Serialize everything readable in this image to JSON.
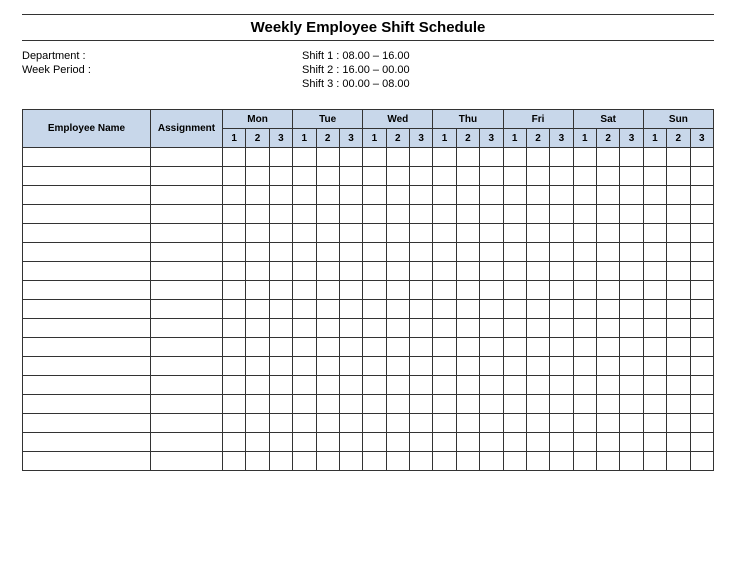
{
  "title": "Weekly Employee Shift Schedule",
  "meta": {
    "department_label": "Department    :",
    "week_period_label": "Week Period :",
    "shift1": "Shift 1  : 08.00  – 16.00",
    "shift2": "Shift 2  : 16.00  – 00.00",
    "shift3": "Shift 3  : 00.00  – 08.00"
  },
  "headers": {
    "employee": "Employee Name",
    "assignment": "Assignment",
    "days": [
      "Mon",
      "Tue",
      "Wed",
      "Thu",
      "Fri",
      "Sat",
      "Sun"
    ],
    "shifts": [
      "1",
      "2",
      "3"
    ]
  },
  "rows": [
    {
      "employee": "",
      "assignment": "",
      "cells": [
        "",
        "",
        "",
        "",
        "",
        "",
        "",
        "",
        "",
        "",
        "",
        "",
        "",
        "",
        "",
        "",
        "",
        "",
        "",
        "",
        ""
      ]
    },
    {
      "employee": "",
      "assignment": "",
      "cells": [
        "",
        "",
        "",
        "",
        "",
        "",
        "",
        "",
        "",
        "",
        "",
        "",
        "",
        "",
        "",
        "",
        "",
        "",
        "",
        "",
        ""
      ]
    },
    {
      "employee": "",
      "assignment": "",
      "cells": [
        "",
        "",
        "",
        "",
        "",
        "",
        "",
        "",
        "",
        "",
        "",
        "",
        "",
        "",
        "",
        "",
        "",
        "",
        "",
        "",
        ""
      ]
    },
    {
      "employee": "",
      "assignment": "",
      "cells": [
        "",
        "",
        "",
        "",
        "",
        "",
        "",
        "",
        "",
        "",
        "",
        "",
        "",
        "",
        "",
        "",
        "",
        "",
        "",
        "",
        ""
      ]
    },
    {
      "employee": "",
      "assignment": "",
      "cells": [
        "",
        "",
        "",
        "",
        "",
        "",
        "",
        "",
        "",
        "",
        "",
        "",
        "",
        "",
        "",
        "",
        "",
        "",
        "",
        "",
        ""
      ]
    },
    {
      "employee": "",
      "assignment": "",
      "cells": [
        "",
        "",
        "",
        "",
        "",
        "",
        "",
        "",
        "",
        "",
        "",
        "",
        "",
        "",
        "",
        "",
        "",
        "",
        "",
        "",
        ""
      ]
    },
    {
      "employee": "",
      "assignment": "",
      "cells": [
        "",
        "",
        "",
        "",
        "",
        "",
        "",
        "",
        "",
        "",
        "",
        "",
        "",
        "",
        "",
        "",
        "",
        "",
        "",
        "",
        ""
      ]
    },
    {
      "employee": "",
      "assignment": "",
      "cells": [
        "",
        "",
        "",
        "",
        "",
        "",
        "",
        "",
        "",
        "",
        "",
        "",
        "",
        "",
        "",
        "",
        "",
        "",
        "",
        "",
        ""
      ]
    },
    {
      "employee": "",
      "assignment": "",
      "cells": [
        "",
        "",
        "",
        "",
        "",
        "",
        "",
        "",
        "",
        "",
        "",
        "",
        "",
        "",
        "",
        "",
        "",
        "",
        "",
        "",
        ""
      ]
    },
    {
      "employee": "",
      "assignment": "",
      "cells": [
        "",
        "",
        "",
        "",
        "",
        "",
        "",
        "",
        "",
        "",
        "",
        "",
        "",
        "",
        "",
        "",
        "",
        "",
        "",
        "",
        ""
      ]
    },
    {
      "employee": "",
      "assignment": "",
      "cells": [
        "",
        "",
        "",
        "",
        "",
        "",
        "",
        "",
        "",
        "",
        "",
        "",
        "",
        "",
        "",
        "",
        "",
        "",
        "",
        "",
        ""
      ]
    },
    {
      "employee": "",
      "assignment": "",
      "cells": [
        "",
        "",
        "",
        "",
        "",
        "",
        "",
        "",
        "",
        "",
        "",
        "",
        "",
        "",
        "",
        "",
        "",
        "",
        "",
        "",
        ""
      ]
    },
    {
      "employee": "",
      "assignment": "",
      "cells": [
        "",
        "",
        "",
        "",
        "",
        "",
        "",
        "",
        "",
        "",
        "",
        "",
        "",
        "",
        "",
        "",
        "",
        "",
        "",
        "",
        ""
      ]
    },
    {
      "employee": "",
      "assignment": "",
      "cells": [
        "",
        "",
        "",
        "",
        "",
        "",
        "",
        "",
        "",
        "",
        "",
        "",
        "",
        "",
        "",
        "",
        "",
        "",
        "",
        "",
        ""
      ]
    },
    {
      "employee": "",
      "assignment": "",
      "cells": [
        "",
        "",
        "",
        "",
        "",
        "",
        "",
        "",
        "",
        "",
        "",
        "",
        "",
        "",
        "",
        "",
        "",
        "",
        "",
        "",
        ""
      ]
    },
    {
      "employee": "",
      "assignment": "",
      "cells": [
        "",
        "",
        "",
        "",
        "",
        "",
        "",
        "",
        "",
        "",
        "",
        "",
        "",
        "",
        "",
        "",
        "",
        "",
        "",
        "",
        ""
      ]
    },
    {
      "employee": "",
      "assignment": "",
      "cells": [
        "",
        "",
        "",
        "",
        "",
        "",
        "",
        "",
        "",
        "",
        "",
        "",
        "",
        "",
        "",
        "",
        "",
        "",
        "",
        "",
        ""
      ]
    }
  ]
}
